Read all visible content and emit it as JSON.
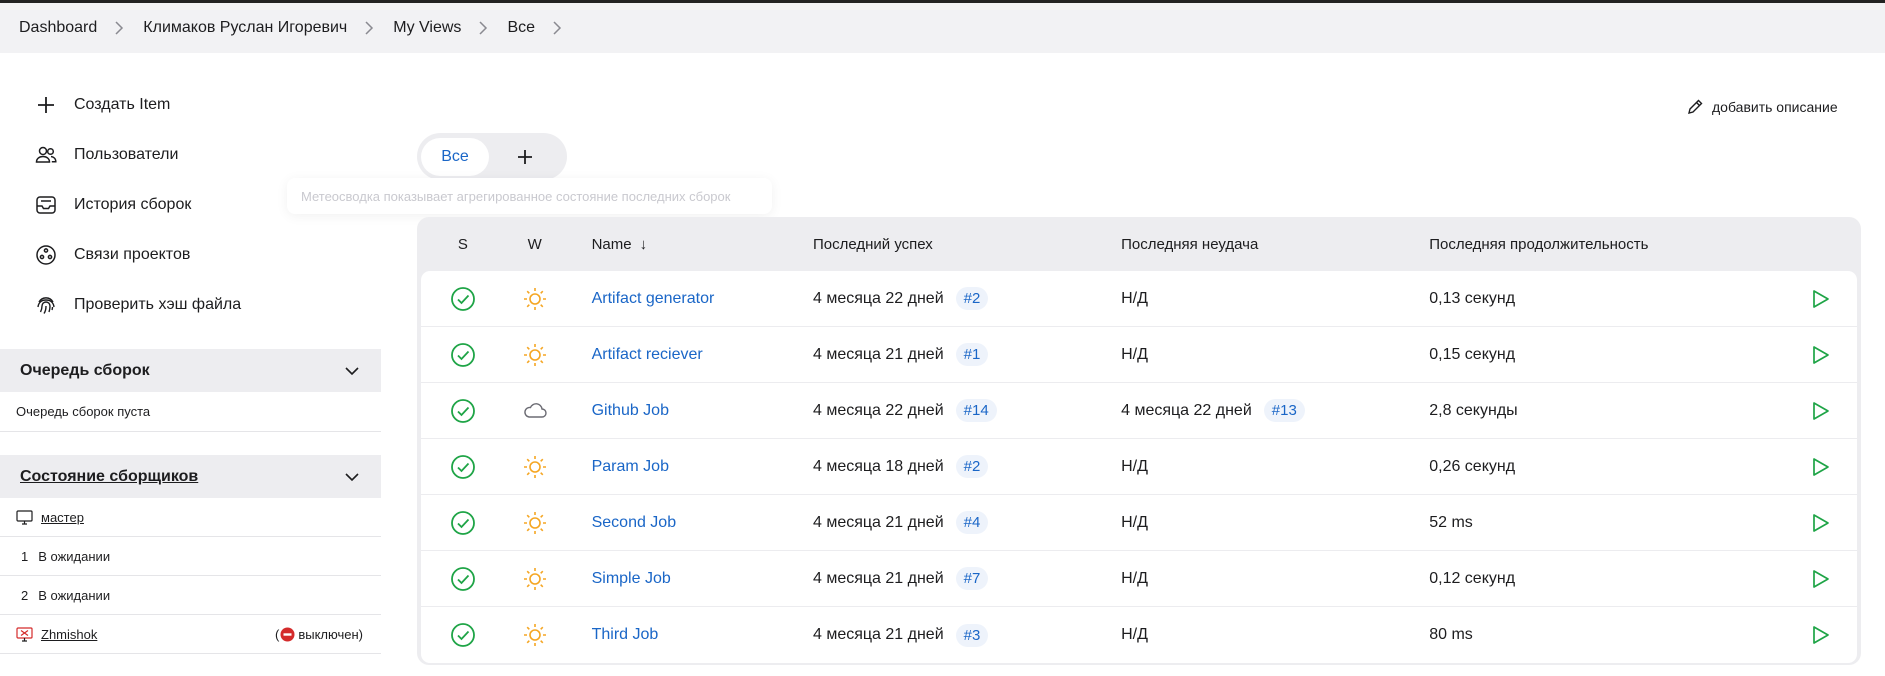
{
  "breadcrumb": [
    "Dashboard",
    "Климаков Руслан Игоревич",
    "My Views",
    "Все"
  ],
  "tasks": [
    {
      "label": "Создать Item",
      "icon": "plus-icon"
    },
    {
      "label": "Пользователи",
      "icon": "users-icon"
    },
    {
      "label": "История сборок",
      "icon": "inbox-icon"
    },
    {
      "label": "Связи проектов",
      "icon": "relations-icon"
    },
    {
      "label": "Проверить хэш файла",
      "icon": "fingerprint-icon"
    }
  ],
  "build_queue": {
    "title": "Очередь сборок",
    "empty_text": "Очередь сборок пуста"
  },
  "executors": {
    "title": "Состояние сборщиков",
    "master": "мастер",
    "slots": [
      {
        "num": "1",
        "status": "В ожидании"
      },
      {
        "num": "2",
        "status": "В ожидании"
      }
    ],
    "agent": "Zhmishok",
    "agent_status": "выключен)",
    "agent_status_open": "("
  },
  "tabs": {
    "active": "Все"
  },
  "tooltip": "Метеосводка показывает агрегированное состояние последних сборок",
  "add_description": "добавить описание",
  "table": {
    "headers": {
      "s": "S",
      "w": "W",
      "name": "Name",
      "sort_arrow": "↓",
      "last_success": "Последний успех",
      "last_failure": "Последняя неудача",
      "last_duration": "Последняя продолжительность"
    },
    "rows": [
      {
        "name": "Artifact generator",
        "weather": "sunny",
        "success_time": "4 месяца 22 дней",
        "success_build": "#2",
        "failure": "Н/Д",
        "failure_build": "",
        "duration": "0,13 секунд"
      },
      {
        "name": "Artifact reciever",
        "weather": "sunny",
        "success_time": "4 месяца 21 дней",
        "success_build": "#1",
        "failure": "Н/Д",
        "failure_build": "",
        "duration": "0,15 секунд"
      },
      {
        "name": "Github Job",
        "weather": "cloudy",
        "success_time": "4 месяца 22 дней",
        "success_build": "#14",
        "failure": "4 месяца 22 дней",
        "failure_build": "#13",
        "duration": "2,8 секунды"
      },
      {
        "name": "Param Job",
        "weather": "sunny",
        "success_time": "4 месяца 18 дней",
        "success_build": "#2",
        "failure": "Н/Д",
        "failure_build": "",
        "duration": "0,26 секунд"
      },
      {
        "name": "Second Job",
        "weather": "sunny",
        "success_time": "4 месяца 21 дней",
        "success_build": "#4",
        "failure": "Н/Д",
        "failure_build": "",
        "duration": "52 ms"
      },
      {
        "name": "Simple Job",
        "weather": "sunny",
        "success_time": "4 месяца 21 дней",
        "success_build": "#7",
        "failure": "Н/Д",
        "failure_build": "",
        "duration": "0,12 секунд"
      },
      {
        "name": "Third Job",
        "weather": "sunny",
        "success_time": "4 месяца 21 дней",
        "success_build": "#3",
        "failure": "Н/Д",
        "failure_build": "",
        "duration": "80 ms"
      }
    ]
  },
  "colors": {
    "accent": "#1a66c7",
    "success": "#1ea446",
    "sun": "#f5a623",
    "panel_bg": "#ededf0"
  }
}
